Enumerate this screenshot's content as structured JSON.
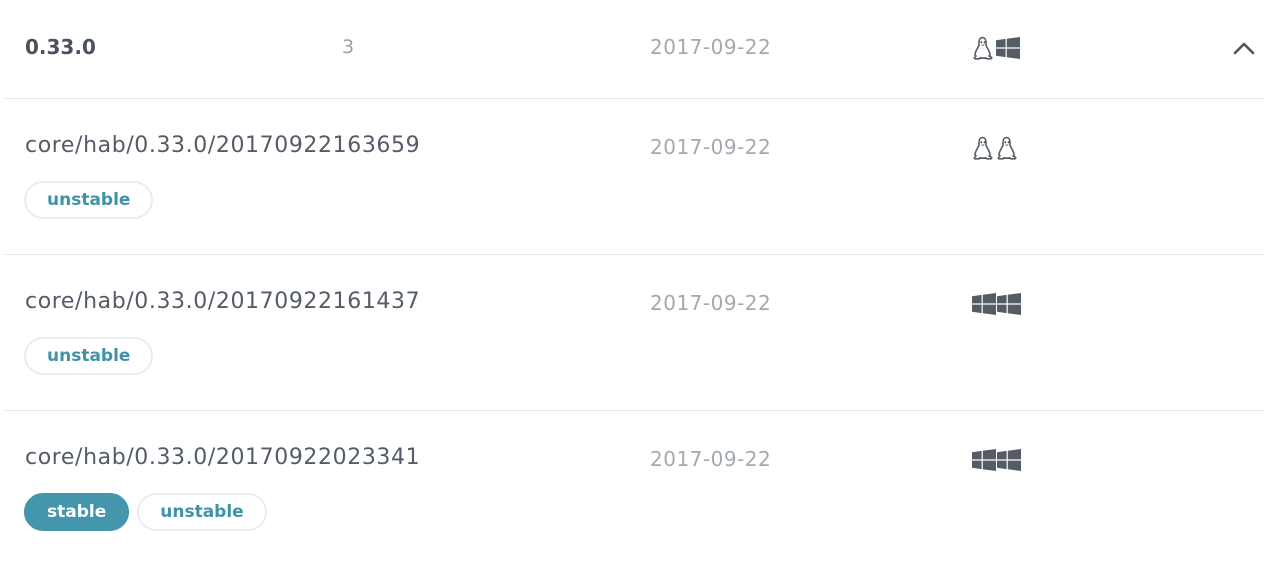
{
  "version_group": {
    "version": "0.33.0",
    "release_count": "3",
    "date": "2017-09-22",
    "platforms": [
      "linux-icon",
      "windows-icon"
    ],
    "expanded": true
  },
  "releases": [
    {
      "ident": "core/hab/0.33.0/20170922163659",
      "date": "2017-09-22",
      "platforms": [
        "linux-icon",
        "linux-icon"
      ],
      "channels": [
        {
          "label": "unstable",
          "style": "outline"
        }
      ]
    },
    {
      "ident": "core/hab/0.33.0/20170922161437",
      "date": "2017-09-22",
      "platforms": [
        "windows-icon",
        "windows-icon"
      ],
      "channels": [
        {
          "label": "unstable",
          "style": "outline"
        }
      ]
    },
    {
      "ident": "core/hab/0.33.0/20170922023341",
      "date": "2017-09-22",
      "platforms": [
        "windows-icon",
        "windows-icon"
      ],
      "channels": [
        {
          "label": "stable",
          "style": "filled"
        },
        {
          "label": "unstable",
          "style": "outline"
        }
      ]
    }
  ],
  "colors": {
    "accent": "#4496ac",
    "text": "#545c68",
    "muted": "#a3a9b0",
    "divider": "#e4e8ec"
  }
}
